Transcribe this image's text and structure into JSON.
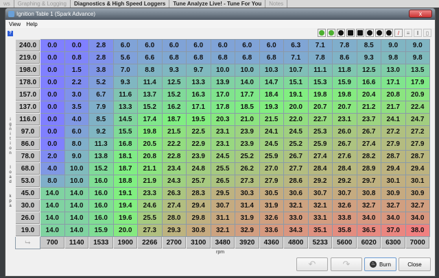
{
  "top_tabs": [
    "ws",
    "Graphing & Logging",
    "Diagnostics & High Speed Loggers",
    "Tune Analyze Live! - Tune For You",
    "Notes"
  ],
  "window": {
    "title": "Ignition Table 1 (Spark Advance)",
    "close": "x"
  },
  "menu": [
    "View",
    "Help"
  ],
  "y_axis_label": "ignition load kpa",
  "x_axis_label": "rpm",
  "corner": "⮡",
  "rpm": [
    "700",
    "1140",
    "1533",
    "1900",
    "2266",
    "2700",
    "3100",
    "3480",
    "3920",
    "4360",
    "4800",
    "5233",
    "5600",
    "6020",
    "6300",
    "7000"
  ],
  "rows": [
    {
      "load": "240.0",
      "v": [
        0.0,
        0.0,
        2.8,
        6.0,
        6.0,
        6.0,
        6.0,
        6.0,
        6.0,
        6.0,
        6.3,
        7.1,
        7.8,
        8.5,
        9.0,
        9.0
      ]
    },
    {
      "load": "219.0",
      "v": [
        0.0,
        0.8,
        2.8,
        5.6,
        6.6,
        6.8,
        6.8,
        6.8,
        6.8,
        6.8,
        7.1,
        7.8,
        8.6,
        9.3,
        9.8,
        9.8
      ]
    },
    {
      "load": "198.0",
      "v": [
        0.0,
        1.5,
        3.8,
        7.0,
        8.8,
        9.3,
        9.7,
        10.0,
        10.0,
        10.3,
        10.7,
        11.1,
        11.8,
        12.5,
        13.0,
        13.5
      ]
    },
    {
      "load": "178.0",
      "v": [
        0.0,
        2.2,
        5.2,
        9.3,
        11.4,
        12.5,
        13.3,
        13.9,
        14.0,
        14.7,
        15.1,
        15.3,
        15.9,
        16.6,
        17.1,
        17.9
      ]
    },
    {
      "load": "157.0",
      "v": [
        0.0,
        3.0,
        6.7,
        11.6,
        13.7,
        15.2,
        16.3,
        17.0,
        17.7,
        18.4,
        19.1,
        19.8,
        19.8,
        20.4,
        20.8,
        20.9
      ]
    },
    {
      "load": "137.0",
      "v": [
        0.0,
        3.5,
        7.9,
        13.3,
        15.2,
        16.2,
        17.1,
        17.8,
        18.5,
        19.3,
        20.0,
        20.7,
        20.7,
        21.2,
        21.7,
        22.4
      ]
    },
    {
      "load": "116.0",
      "v": [
        0.0,
        4.0,
        8.5,
        14.5,
        17.4,
        18.7,
        19.5,
        20.3,
        21.0,
        21.5,
        22.0,
        22.7,
        23.1,
        23.7,
        24.1,
        24.7
      ]
    },
    {
      "load": "97.0",
      "v": [
        0.0,
        6.0,
        9.2,
        15.5,
        19.8,
        21.5,
        22.5,
        23.1,
        23.9,
        24.1,
        24.5,
        25.3,
        26.0,
        26.7,
        27.2,
        27.2
      ]
    },
    {
      "load": "86.0",
      "v": [
        0.0,
        8.0,
        11.3,
        16.8,
        20.5,
        22.2,
        22.9,
        23.1,
        23.9,
        24.5,
        25.2,
        25.9,
        26.7,
        27.4,
        27.9,
        27.9
      ]
    },
    {
      "load": "78.0",
      "v": [
        2.0,
        9.0,
        13.8,
        18.1,
        20.8,
        22.8,
        23.9,
        24.5,
        25.2,
        25.9,
        26.7,
        27.4,
        27.6,
        28.2,
        28.7,
        28.7
      ]
    },
    {
      "load": "68.0",
      "v": [
        4.0,
        10.0,
        15.2,
        18.7,
        21.1,
        23.4,
        24.8,
        25.5,
        26.2,
        27.0,
        27.7,
        28.4,
        28.4,
        28.9,
        29.4,
        29.4
      ]
    },
    {
      "load": "53.0",
      "v": [
        8.0,
        10.0,
        16.0,
        18.8,
        21.9,
        24.3,
        25.7,
        26.5,
        27.3,
        27.9,
        28.6,
        29.2,
        29.2,
        29.7,
        30.1,
        30.1
      ]
    },
    {
      "load": "45.0",
      "v": [
        14.0,
        14.0,
        16.0,
        19.1,
        23.3,
        26.3,
        28.3,
        29.5,
        30.3,
        30.5,
        30.6,
        30.7,
        30.7,
        30.8,
        30.9,
        30.9
      ]
    },
    {
      "load": "30.0",
      "v": [
        14.0,
        14.0,
        16.0,
        19.4,
        24.6,
        27.4,
        29.4,
        30.7,
        31.4,
        31.9,
        32.1,
        32.1,
        32.6,
        32.7,
        32.7,
        32.7
      ]
    },
    {
      "load": "26.0",
      "v": [
        14.0,
        14.0,
        16.0,
        19.6,
        25.5,
        28.0,
        29.8,
        31.1,
        31.9,
        32.6,
        33.0,
        33.1,
        33.8,
        34.0,
        34.0,
        34.0
      ]
    },
    {
      "load": "19.0",
      "v": [
        14.0,
        14.0,
        15.9,
        20.0,
        27.3,
        29.3,
        30.8,
        32.1,
        32.9,
        33.6,
        34.3,
        35.1,
        35.8,
        36.5,
        37.0,
        38.0
      ]
    }
  ],
  "buttons": {
    "undo": "↶",
    "redo": "↷",
    "burn": "Burn",
    "close": "Close"
  },
  "colors": {
    "low": "#8080ff",
    "mid": "#80f080",
    "high": "#f08080"
  }
}
